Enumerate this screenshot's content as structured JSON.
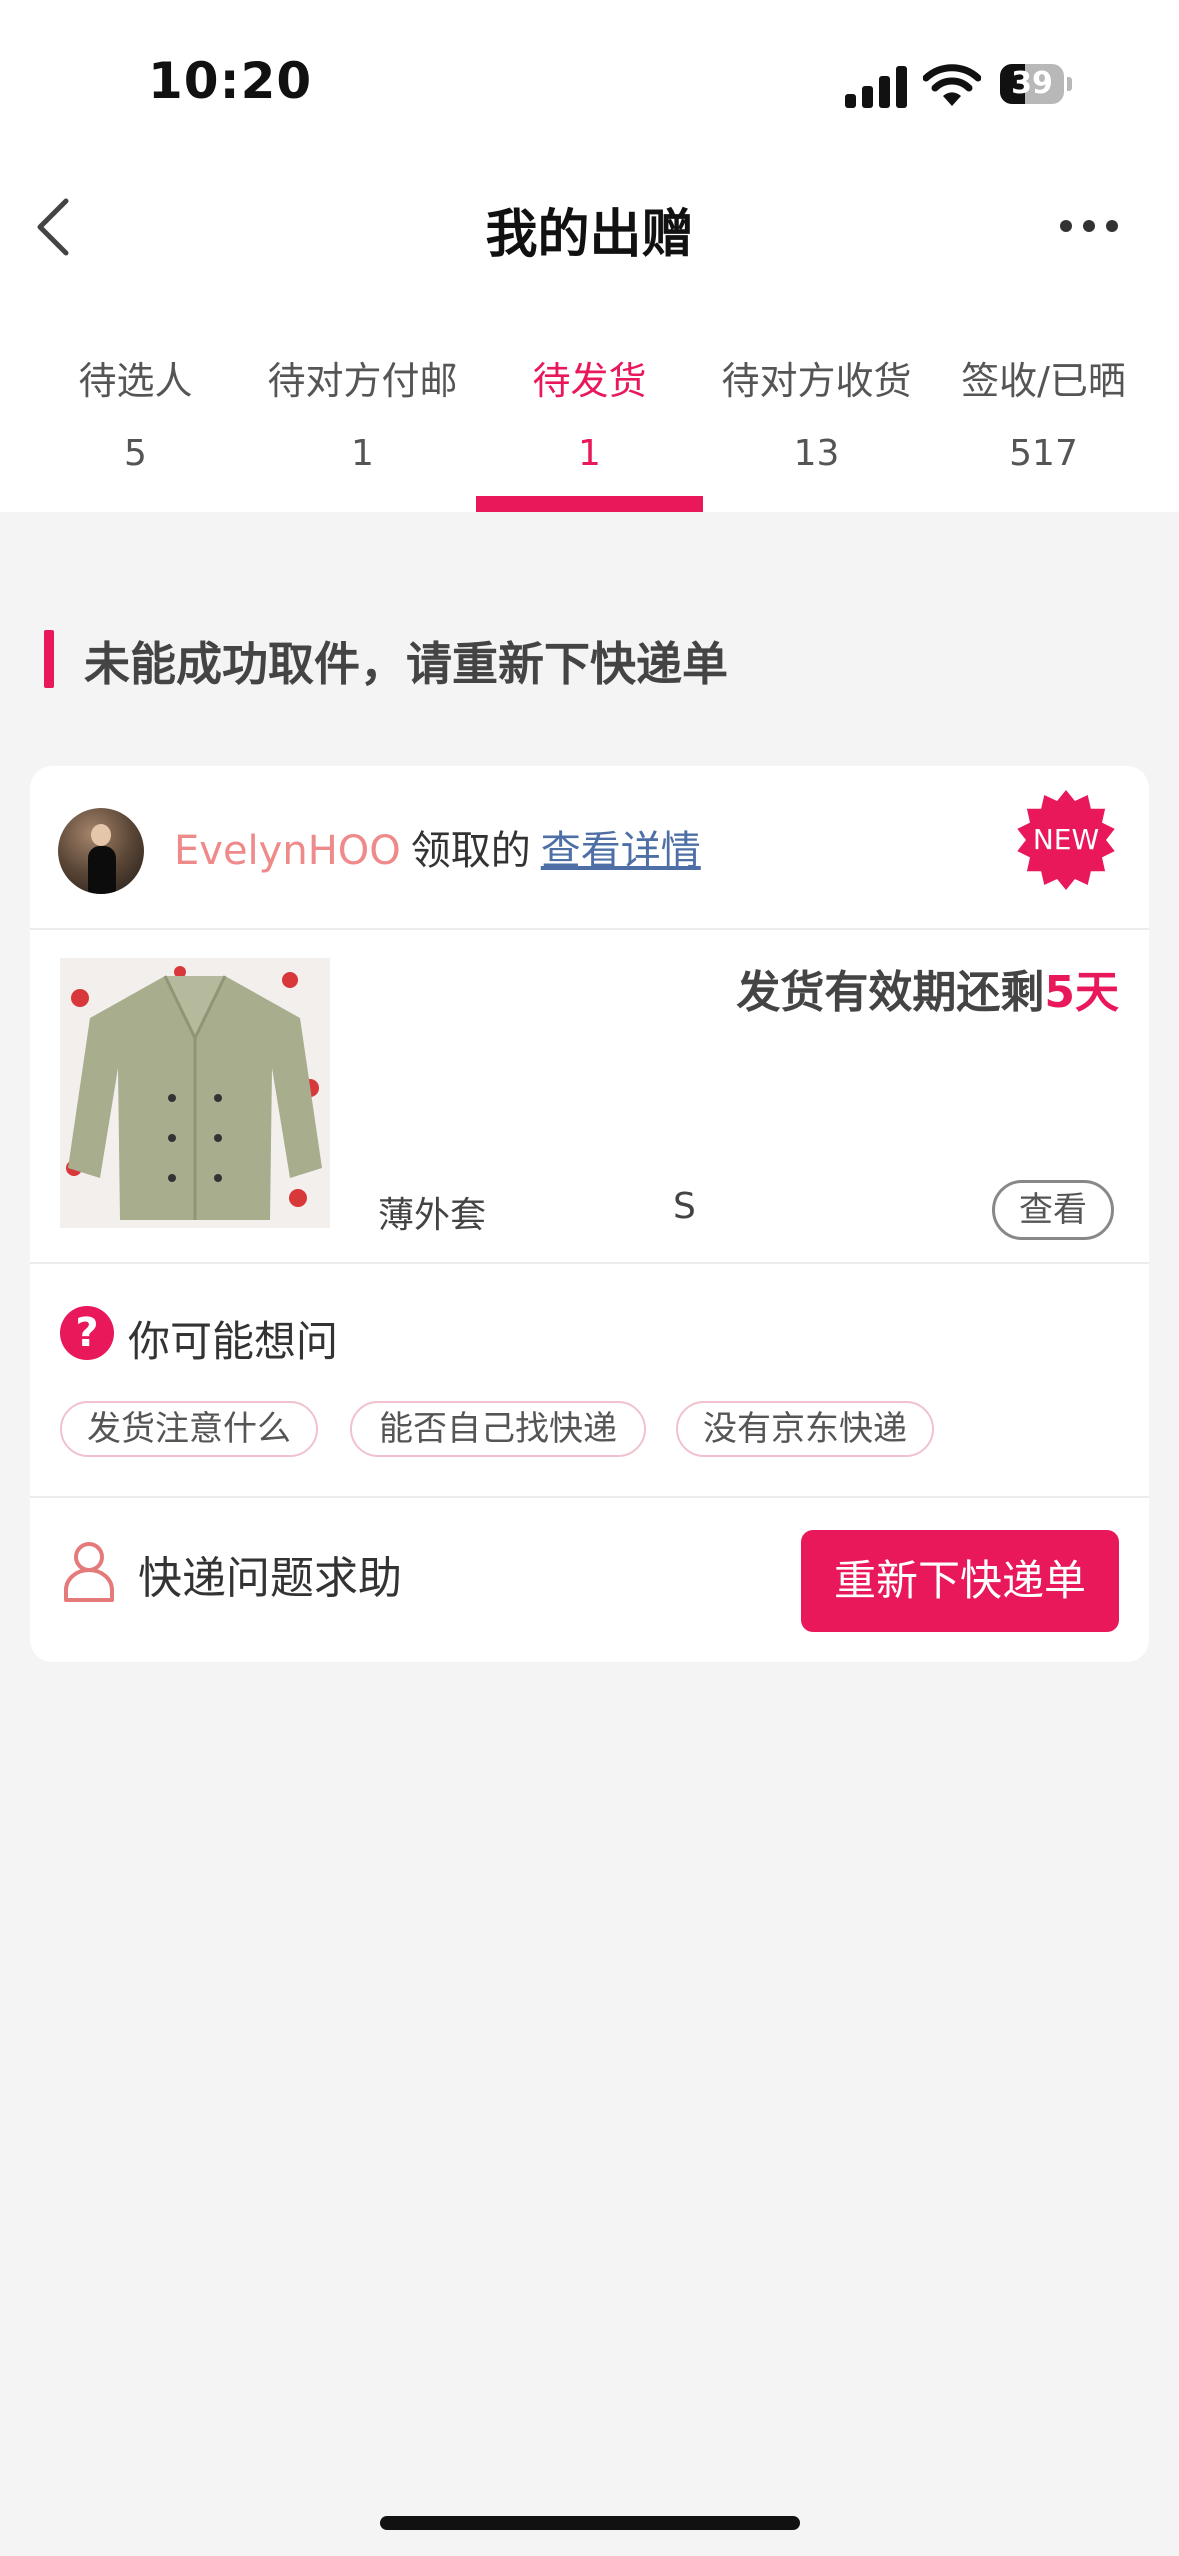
{
  "status_bar": {
    "time": "10:20",
    "battery": "39"
  },
  "nav": {
    "title": "我的出赠"
  },
  "tabs": [
    {
      "label": "待选人",
      "count": "5",
      "active": false
    },
    {
      "label": "待对方付邮",
      "count": "1",
      "active": false
    },
    {
      "label": "待发货",
      "count": "1",
      "active": true
    },
    {
      "label": "待对方收货",
      "count": "13",
      "active": false
    },
    {
      "label": "签收/已晒",
      "count": "517",
      "active": false
    }
  ],
  "section": {
    "title": "未能成功取件，请重新下快递单"
  },
  "order": {
    "username": "EvelynHOO",
    "claim_text": "领取的",
    "detail_link": "查看详情",
    "new_badge": "NEW",
    "deadline_prefix": "发货有效期还剩",
    "deadline_days": "5天",
    "item_name": "薄外套",
    "item_size": "S",
    "view_button": "查看"
  },
  "faq": {
    "title": "你可能想问",
    "chips": [
      "发货注意什么",
      "能否自己找快递",
      "没有京东快递"
    ]
  },
  "help": {
    "label": "快递问题求助",
    "rebook_button": "重新下快递单"
  },
  "colors": {
    "accent": "#e8185a",
    "username": "#ef8a8a",
    "link": "#4e6fa5"
  },
  "icons": [
    "signal-icon",
    "wifi-icon",
    "battery-icon",
    "back-icon",
    "more-icon",
    "new-badge-icon",
    "question-icon",
    "person-icon"
  ]
}
